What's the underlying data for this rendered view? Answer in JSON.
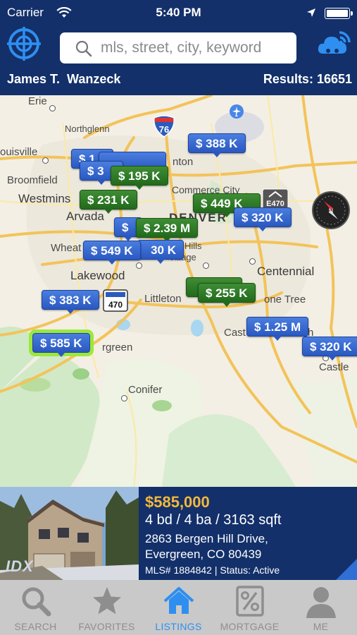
{
  "status_bar": {
    "carrier": "Carrier",
    "time": "5:40 PM"
  },
  "header": {
    "search_placeholder": "mls, street, city, keyword",
    "user_name": "James T.  Wanzeck",
    "results": "Results: 16651"
  },
  "map": {
    "cities": [
      "Erie",
      "ouisville",
      "Northglenn",
      "Broomfield",
      "Westmins",
      "Commerce City",
      "Arvada",
      "DENVER",
      "Wheat",
      "Hills",
      "Village",
      "Lakewood",
      "Centennial",
      "Littleton",
      "one Tree",
      "Cast",
      "h",
      "rgreen",
      "Castle",
      "Conifer",
      "nton"
    ],
    "highway_shields": [
      "76",
      "470",
      "E470"
    ],
    "pins": [
      {
        "label": "$ 1",
        "color": "blue"
      },
      {
        "label": "$ 388 K",
        "color": "blue"
      },
      {
        "label": "$ 3",
        "color": "blue"
      },
      {
        "label": "$ 195 K",
        "color": "green"
      },
      {
        "label": "$ 231 K",
        "color": "green"
      },
      {
        "label": "$ 449 K",
        "color": "green"
      },
      {
        "label": "$ 320 K",
        "color": "blue"
      },
      {
        "label": "$",
        "color": "blue"
      },
      {
        "label": "$ 2.39 M",
        "color": "green"
      },
      {
        "label": "$ 549 K",
        "color": "blue"
      },
      {
        "label": "30 K",
        "color": "blue"
      },
      {
        "label": "$ 383 K",
        "color": "blue"
      },
      {
        "label": "$ 255 K",
        "color": "green"
      },
      {
        "label": "$ 1.25 M",
        "color": "blue"
      },
      {
        "label": "$ 585 K",
        "color": "blue",
        "selected": true
      },
      {
        "label": "$ 320 K",
        "color": "blue"
      }
    ]
  },
  "listing": {
    "price": "$585,000",
    "details": "4 bd / 4 ba / 3163 sqft",
    "address_line1": "2863 Bergen Hill Drive,",
    "address_line2": "Evergreen, CO 80439",
    "mls_status": "MLS# 1884842 | Status: Active",
    "photo_watermark": "IDX"
  },
  "tabs": [
    {
      "label": "SEARCH",
      "icon": "search-icon"
    },
    {
      "label": "FAVORITES",
      "icon": "star-icon"
    },
    {
      "label": "LISTINGS",
      "icon": "home-icon",
      "active": true
    },
    {
      "label": "MORTGAGE",
      "icon": "percent-icon"
    },
    {
      "label": "ME",
      "icon": "person-icon"
    }
  ],
  "colors": {
    "header_bg": "#13306a",
    "price_gold": "#f4b83a",
    "pin_blue": "#2a58c0",
    "pin_green": "#226a1c",
    "selected": "#9be83a",
    "tab_active": "#2f8ff0"
  }
}
